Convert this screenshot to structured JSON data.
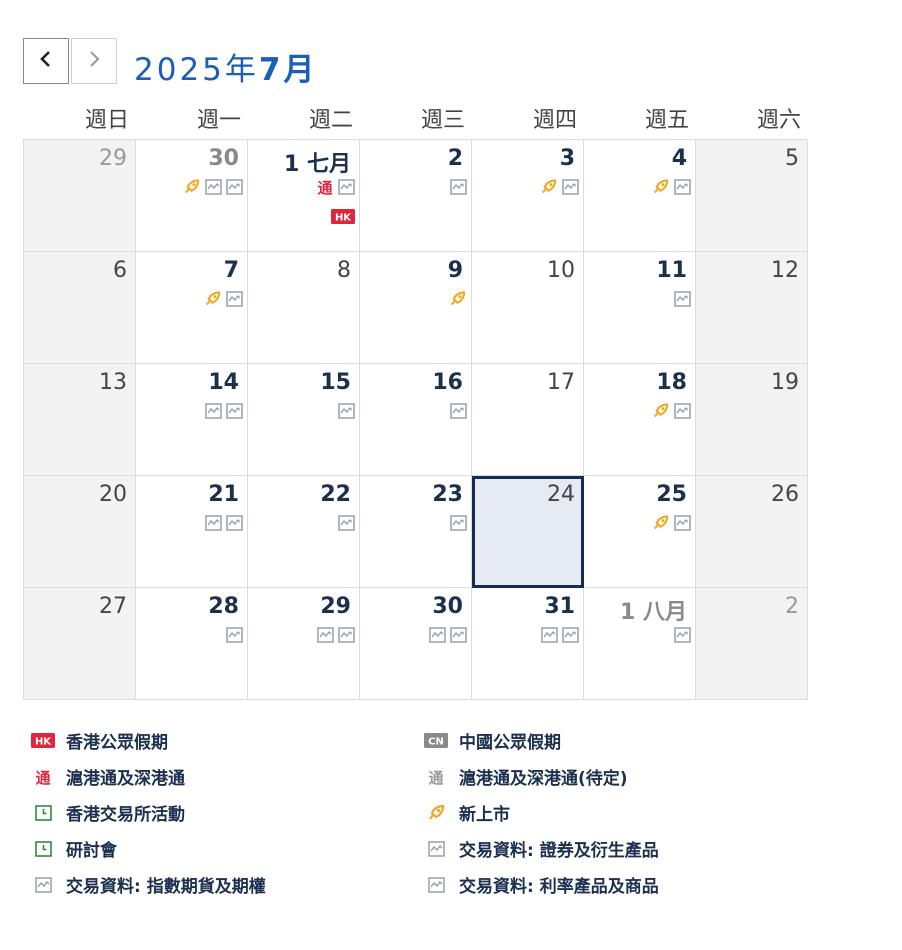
{
  "header": {
    "year_label": "2025年",
    "month_label": "7月"
  },
  "weekdays": [
    "週日",
    "週一",
    "週二",
    "週三",
    "週四",
    "週五",
    "週六"
  ],
  "days": [
    {
      "label": "29",
      "muted": true,
      "bold": false,
      "weekend": true,
      "icons": []
    },
    {
      "label": "30",
      "muted": true,
      "bold": true,
      "weekend": false,
      "icons": [
        "ipo-icon",
        "chart-icon",
        "chart-icon"
      ]
    },
    {
      "label": "1 七月",
      "muted": false,
      "bold": true,
      "weekend": false,
      "icons": [
        "connect-icon",
        "chart-icon"
      ],
      "icons2": [
        "hk-holiday-icon"
      ]
    },
    {
      "label": "2",
      "muted": false,
      "bold": true,
      "weekend": false,
      "icons": [
        "chart-icon"
      ]
    },
    {
      "label": "3",
      "muted": false,
      "bold": true,
      "weekend": false,
      "icons": [
        "ipo-icon",
        "chart-icon"
      ]
    },
    {
      "label": "4",
      "muted": false,
      "bold": true,
      "weekend": false,
      "icons": [
        "ipo-icon",
        "chart-icon"
      ]
    },
    {
      "label": "5",
      "muted": false,
      "bold": false,
      "weekend": true,
      "icons": []
    },
    {
      "label": "6",
      "muted": false,
      "bold": false,
      "weekend": true,
      "icons": []
    },
    {
      "label": "7",
      "muted": false,
      "bold": true,
      "weekend": false,
      "icons": [
        "ipo-icon",
        "chart-icon"
      ]
    },
    {
      "label": "8",
      "muted": false,
      "bold": false,
      "weekend": false,
      "icons": []
    },
    {
      "label": "9",
      "muted": false,
      "bold": true,
      "weekend": false,
      "icons": [
        "ipo-icon"
      ]
    },
    {
      "label": "10",
      "muted": false,
      "bold": false,
      "weekend": false,
      "icons": []
    },
    {
      "label": "11",
      "muted": false,
      "bold": true,
      "weekend": false,
      "icons": [
        "chart-icon"
      ]
    },
    {
      "label": "12",
      "muted": false,
      "bold": false,
      "weekend": true,
      "icons": []
    },
    {
      "label": "13",
      "muted": false,
      "bold": false,
      "weekend": true,
      "icons": []
    },
    {
      "label": "14",
      "muted": false,
      "bold": true,
      "weekend": false,
      "icons": [
        "chart-icon",
        "chart-icon"
      ]
    },
    {
      "label": "15",
      "muted": false,
      "bold": true,
      "weekend": false,
      "icons": [
        "chart-icon"
      ]
    },
    {
      "label": "16",
      "muted": false,
      "bold": true,
      "weekend": false,
      "icons": [
        "chart-icon"
      ]
    },
    {
      "label": "17",
      "muted": false,
      "bold": false,
      "weekend": false,
      "icons": []
    },
    {
      "label": "18",
      "muted": false,
      "bold": true,
      "weekend": false,
      "icons": [
        "ipo-icon",
        "chart-icon"
      ]
    },
    {
      "label": "19",
      "muted": false,
      "bold": false,
      "weekend": true,
      "icons": []
    },
    {
      "label": "20",
      "muted": false,
      "bold": false,
      "weekend": true,
      "icons": []
    },
    {
      "label": "21",
      "muted": false,
      "bold": true,
      "weekend": false,
      "icons": [
        "chart-icon",
        "chart-icon"
      ]
    },
    {
      "label": "22",
      "muted": false,
      "bold": true,
      "weekend": false,
      "icons": [
        "chart-icon"
      ]
    },
    {
      "label": "23",
      "muted": false,
      "bold": true,
      "weekend": false,
      "icons": [
        "chart-icon"
      ]
    },
    {
      "label": "24",
      "muted": false,
      "bold": false,
      "weekend": false,
      "today": true,
      "icons": []
    },
    {
      "label": "25",
      "muted": false,
      "bold": true,
      "weekend": false,
      "icons": [
        "ipo-icon",
        "chart-icon"
      ]
    },
    {
      "label": "26",
      "muted": false,
      "bold": false,
      "weekend": true,
      "icons": []
    },
    {
      "label": "27",
      "muted": false,
      "bold": false,
      "weekend": true,
      "icons": []
    },
    {
      "label": "28",
      "muted": false,
      "bold": true,
      "weekend": false,
      "icons": [
        "chart-icon"
      ]
    },
    {
      "label": "29",
      "muted": false,
      "bold": true,
      "weekend": false,
      "icons": [
        "chart-icon",
        "chart-icon"
      ]
    },
    {
      "label": "30",
      "muted": false,
      "bold": true,
      "weekend": false,
      "icons": [
        "chart-icon",
        "chart-icon"
      ]
    },
    {
      "label": "31",
      "muted": false,
      "bold": true,
      "weekend": false,
      "icons": [
        "chart-icon",
        "chart-icon"
      ]
    },
    {
      "label": "1 八月",
      "muted": true,
      "bold": true,
      "weekend": false,
      "icons": [
        "chart-icon"
      ]
    },
    {
      "label": "2",
      "muted": true,
      "bold": false,
      "weekend": true,
      "icons": []
    }
  ],
  "legend": [
    {
      "icon": "hk-holiday-icon",
      "label": "香港公眾假期"
    },
    {
      "icon": "cn-holiday-icon",
      "label": "中國公眾假期"
    },
    {
      "icon": "connect-icon",
      "label": "滬港通及深港通"
    },
    {
      "icon": "connect-pending-icon",
      "label": "滬港通及深港通(待定)"
    },
    {
      "icon": "hkex-event-icon",
      "label": "香港交易所活動"
    },
    {
      "icon": "ipo-icon",
      "label": "新上市"
    },
    {
      "icon": "seminar-icon",
      "label": "研討會"
    },
    {
      "icon": "chart-icon",
      "label": "交易資料: 證券及衍生產品"
    },
    {
      "icon": "chart-icon",
      "label": "交易資料: 指數期貨及期權"
    },
    {
      "icon": "chart-icon",
      "label": "交易資料: 利率產品及商品"
    }
  ],
  "icon_text": {
    "hk": "HK",
    "cn": "CN",
    "connect": "通"
  },
  "colors": {
    "accent": "#1a5eb8",
    "navy": "#132c55",
    "holiday_red": "#e0263d",
    "ipo_orange": "#f5a623",
    "event_green": "#2e8b3e",
    "chart_gray": "#8e9aa6"
  }
}
